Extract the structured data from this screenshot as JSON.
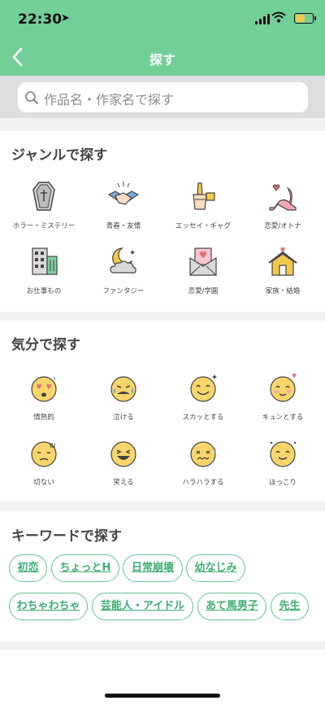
{
  "status": {
    "time": "22:30"
  },
  "header": {
    "title": "探す"
  },
  "search": {
    "placeholder": "作品名・作家名で探す"
  },
  "genre": {
    "title": "ジャンルで探す",
    "items": [
      {
        "label": "ホラー・ミステリー",
        "icon": "coffin-icon"
      },
      {
        "label": "青春・友情",
        "icon": "handshake-icon"
      },
      {
        "label": "エッセイ・ギャグ",
        "icon": "pen-icon"
      },
      {
        "label": "恋愛/オトナ",
        "icon": "high-heel-icon"
      },
      {
        "label": "お仕事もの",
        "icon": "office-building-icon"
      },
      {
        "label": "ファンタジー",
        "icon": "moon-cloud-icon"
      },
      {
        "label": "恋愛/学園",
        "icon": "love-letter-icon"
      },
      {
        "label": "家族・結婚",
        "icon": "house-icon"
      }
    ]
  },
  "mood": {
    "title": "気分で探す",
    "items": [
      {
        "label": "情熱的",
        "icon": "heart-eyes-face-icon"
      },
      {
        "label": "泣ける",
        "icon": "crying-face-icon"
      },
      {
        "label": "スカッとする",
        "icon": "refreshed-face-icon"
      },
      {
        "label": "キュンとする",
        "icon": "blushing-face-icon"
      },
      {
        "label": "切ない",
        "icon": "sad-face-icon"
      },
      {
        "label": "笑える",
        "icon": "laughing-face-icon"
      },
      {
        "label": "ハラハラする",
        "icon": "nervous-face-icon"
      },
      {
        "label": "ほっこり",
        "icon": "smiling-face-icon"
      }
    ]
  },
  "keyword": {
    "title": "キーワードで探す",
    "items": [
      "初恋",
      "ちょっとH",
      "日常崩壊",
      "幼なじみ",
      "わちゃわちゃ",
      "芸能人・アイドル",
      "あて馬男子",
      "先生"
    ]
  },
  "colors": {
    "accent": "#72cf98",
    "keyword": "#3fae72",
    "face": "#f9d66b"
  }
}
